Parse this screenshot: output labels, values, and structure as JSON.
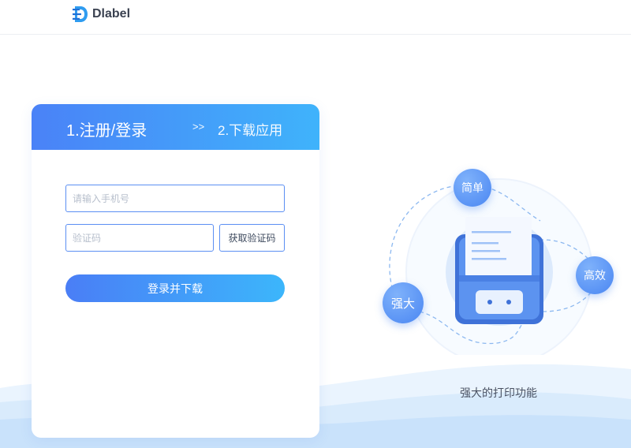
{
  "header": {
    "brand": "Dlabel",
    "logo_icon": "dlabel-logo-icon"
  },
  "login_card": {
    "steps": {
      "step1": "1.注册/登录",
      "arrow": ">>",
      "step2": "2.下载应用"
    },
    "phone_input": {
      "placeholder": "请输入手机号",
      "value": ""
    },
    "code_input": {
      "placeholder": "验证码",
      "value": ""
    },
    "get_code_label": "获取验证码",
    "submit_label": "登录并下载"
  },
  "illustration": {
    "badges": {
      "simple": "简单",
      "efficient": "高效",
      "powerful": "强大"
    },
    "caption": "强大的打印功能",
    "icon": "label-printer-icon"
  },
  "colors": {
    "accent_start": "#4a82f7",
    "accent_end": "#3fb3fb",
    "input_border": "#5b8ff3",
    "wave_light": "#e3f0fd",
    "wave_mid": "#cfe4fb"
  }
}
